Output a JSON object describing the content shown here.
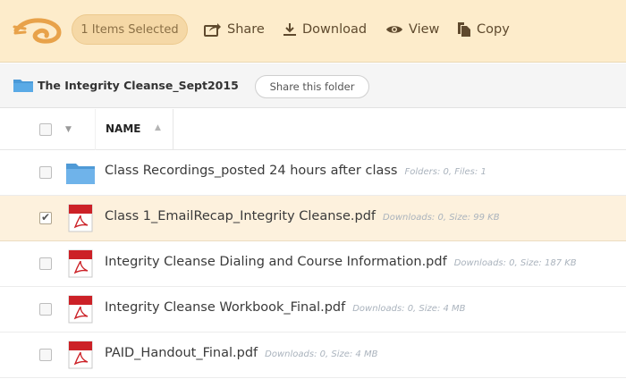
{
  "toolbar": {
    "selection_label": "1 Items Selected",
    "actions": [
      {
        "label": "Share",
        "icon": "share-icon"
      },
      {
        "label": "Download",
        "icon": "download-icon"
      },
      {
        "label": "View",
        "icon": "eye-icon"
      },
      {
        "label": "Copy",
        "icon": "copy-icon"
      }
    ],
    "colors": {
      "background": "#fdeccb",
      "pill": "#f5d8a6",
      "text": "#5f4a2e"
    }
  },
  "breadcrumb": {
    "folder_title": "The Integrity Cleanse_Sept2015",
    "share_button": "Share this folder"
  },
  "table": {
    "column_name": "NAME",
    "rows": [
      {
        "type": "folder",
        "name": "Class Recordings_posted 24 hours after class",
        "meta": "Folders: 0, Files: 1",
        "selected": false
      },
      {
        "type": "pdf",
        "name": "Class 1_EmailRecap_Integrity Cleanse.pdf",
        "meta": "Downloads: 0, Size: 99 KB",
        "selected": true
      },
      {
        "type": "pdf",
        "name": "Integrity Cleanse Dialing and Course Information.pdf",
        "meta": "Downloads: 0, Size: 187 KB",
        "selected": false
      },
      {
        "type": "pdf",
        "name": "Integrity Cleanse Workbook_Final.pdf",
        "meta": "Downloads: 0, Size: 4 MB",
        "selected": false
      },
      {
        "type": "pdf",
        "name": "PAID_Handout_Final.pdf",
        "meta": "Downloads: 0, Size: 4 MB",
        "selected": false
      }
    ]
  }
}
